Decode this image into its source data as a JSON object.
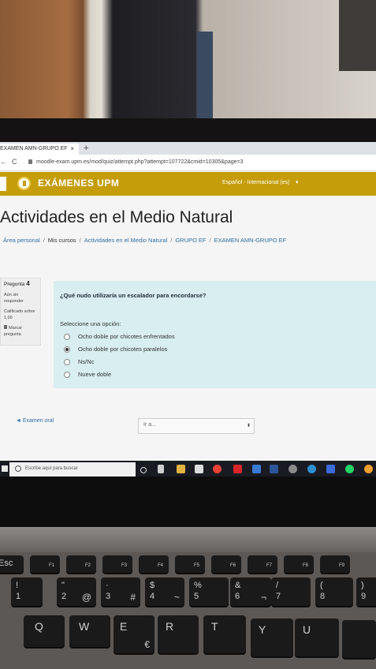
{
  "browser": {
    "tab_title": "EXAMEN AMN-GRUPO EF",
    "tab_close": "×",
    "new_tab": "+",
    "back": "←",
    "reload": "C",
    "url": "moodle-exam.upm.es/mod/quiz/attempt.php?attempt=107722&cmid=10305&page=3"
  },
  "header": {
    "site_name": "EXÁMENES UPM",
    "language": "Español - Internacional (es)",
    "language_caret": "▾"
  },
  "course_title": "Actividades en el Medio Natural",
  "breadcrumb": [
    "Área personal",
    "Mis cursos",
    "Actividades en el Medio Natural",
    "GRUPO EF",
    "EXAMEN AMN-GRUPO EF"
  ],
  "breadcrumb_sep": "/",
  "question_info": {
    "label": "Pregunta",
    "number": "4",
    "status": "Aún sin responder",
    "grade": "Calificado sobre 1,00",
    "flag_label": "Marcar pregunta"
  },
  "question": {
    "text": "¿Qué nudo utilizaría un escalador para encordarse?",
    "prompt": "Seleccione una opción:",
    "options": [
      "Ocho doble por chicotes enfrentados",
      "Ocho doble por chicotes paralelos",
      "Ns/Nc",
      "Nueve doble"
    ],
    "selected_index": 1
  },
  "navigation": {
    "prev_link": "◄ Examen oral",
    "jump_label": "Ir a...",
    "jump_caret": "⬍"
  },
  "taskbar": {
    "search_placeholder": "Escribe aquí para buscar"
  },
  "keyboard": {
    "row1": [
      "1",
      "2",
      "3",
      "4",
      "5",
      "6",
      "7",
      "8",
      "9"
    ],
    "row1_sub": [
      "",
      "@",
      "#",
      "~",
      "",
      "¬",
      "",
      "",
      ""
    ],
    "row1_top": [
      "!",
      "\"",
      "·",
      "$",
      "%",
      "&",
      "/",
      "(",
      ")"
    ],
    "row2": [
      "Q",
      "W",
      "E",
      "R",
      "T",
      "Y",
      "U"
    ],
    "row2_sub": [
      "",
      "",
      "€",
      "",
      "",
      "",
      ""
    ],
    "fn": [
      "Esc",
      "F1",
      "F2",
      "F3",
      "F4",
      "F5",
      "F6",
      "F7",
      "F8",
      "F9"
    ]
  },
  "colors": {
    "header": "#c59d0a",
    "question_bg": "#d8eef0",
    "link": "#2f6ea5"
  }
}
